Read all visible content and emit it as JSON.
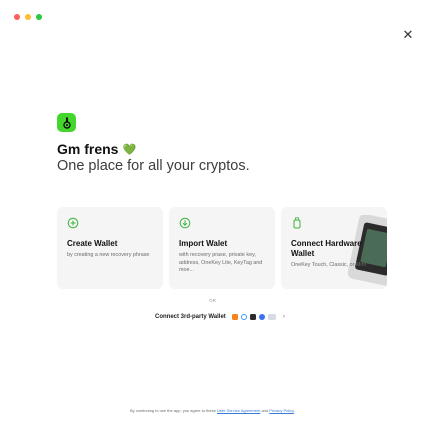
{
  "window": {
    "traffic_colors": [
      "#ff5f57",
      "#febc2e",
      "#28c840"
    ]
  },
  "brand": {
    "logo_color": "#44d62c",
    "headline": "Gm frens",
    "headline_emoji": "💚",
    "subheadline": "One place for all your cryptos."
  },
  "cards": [
    {
      "icon": "plus-circle-icon",
      "title": "Create Wallet",
      "desc": "by creating a new recovery phrase"
    },
    {
      "icon": "arrow-down-circle-icon",
      "title": "Import Walet",
      "desc": "with recovery prase, private key, address, OneKey Lite, KeyTag and moe..."
    },
    {
      "icon": "hardware-device-icon",
      "title": "Connect Hardware Wallet",
      "desc": "OneKey Touch, Classic, or Mini"
    }
  ],
  "accent_color": "#3db33d",
  "or_label": "OR",
  "third_party": {
    "label": "Connect 3rd-party Wallet",
    "wallet_icons": [
      "metamask-icon",
      "walletconnect-icon",
      "trustwallet-icon",
      "coinbase-icon",
      "more-wallets-icon"
    ]
  },
  "footer": {
    "prefix": "By continuing to use the app, you agree to these",
    "terms": "User Service Agreement",
    "and": "and",
    "privacy": "Privacy Policy",
    "suffix": "."
  }
}
